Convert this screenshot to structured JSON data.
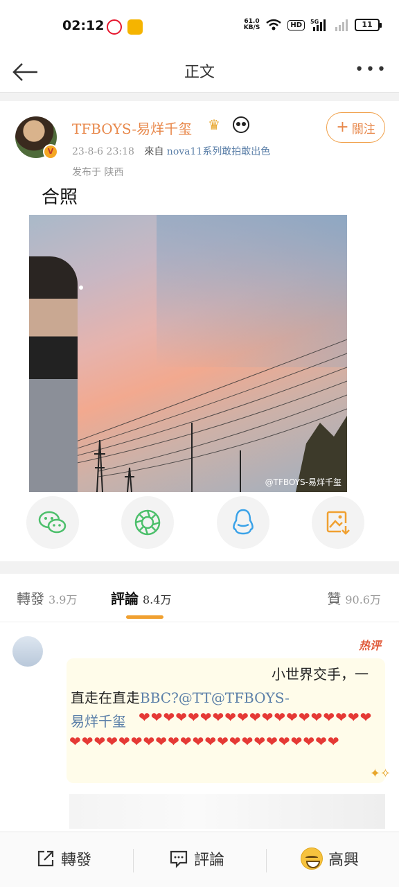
{
  "status_bar": {
    "time": "02:12",
    "net_speed_value": "61.0",
    "net_speed_unit": "KB/S",
    "hd_label": "HD",
    "signal_label": "5G",
    "battery": "11"
  },
  "nav": {
    "title": "正文",
    "back_icon": "back-arrow-icon",
    "more_icon": "more-dots-icon"
  },
  "post": {
    "username": "TFBOYS-易烊千玺",
    "timestamp": "23-8-6 23:18",
    "source_prefix": "來自",
    "source": "nova11系列敢拍敢出色",
    "location": "发布于 陕西",
    "follow_label": "關注",
    "text": "合照",
    "photo_watermark": "@TFBOYS-易烊千玺"
  },
  "share": [
    {
      "name": "wechat",
      "icon": "wechat-icon",
      "color": "#4cbf6b"
    },
    {
      "name": "moments",
      "icon": "moments-icon",
      "color": "#4cbf6b"
    },
    {
      "name": "qq",
      "icon": "qq-icon",
      "color": "#3aa2e8"
    },
    {
      "name": "save-image",
      "icon": "save-image-icon",
      "color": "#f0a030"
    }
  ],
  "tabs": {
    "repost_label": "轉發",
    "repost_count": "3.9万",
    "comment_label": "評論",
    "comment_count": "8.4万",
    "like_label": "贊",
    "like_count": "90.6万"
  },
  "comment": {
    "hot_label": "热评",
    "text_line1": "小世界交手，一",
    "text_line2_prefix": "直走在直走",
    "text_mention": "BBC?@TT@TFBOYS-",
    "text_line3": "易烊千玺",
    "hearts": "❤❤❤❤❤❤❤❤❤❤❤❤❤❤❤❤❤❤❤❤❤❤❤❤❤❤❤❤❤❤❤❤❤❤❤❤❤❤❤❤❤"
  },
  "bottom_bar": {
    "repost_label": "轉發",
    "comment_label": "評論",
    "like_label": "高興"
  },
  "colors": {
    "accent": "#f0a030",
    "username": "#e8884b",
    "link": "#5b7fa8"
  }
}
